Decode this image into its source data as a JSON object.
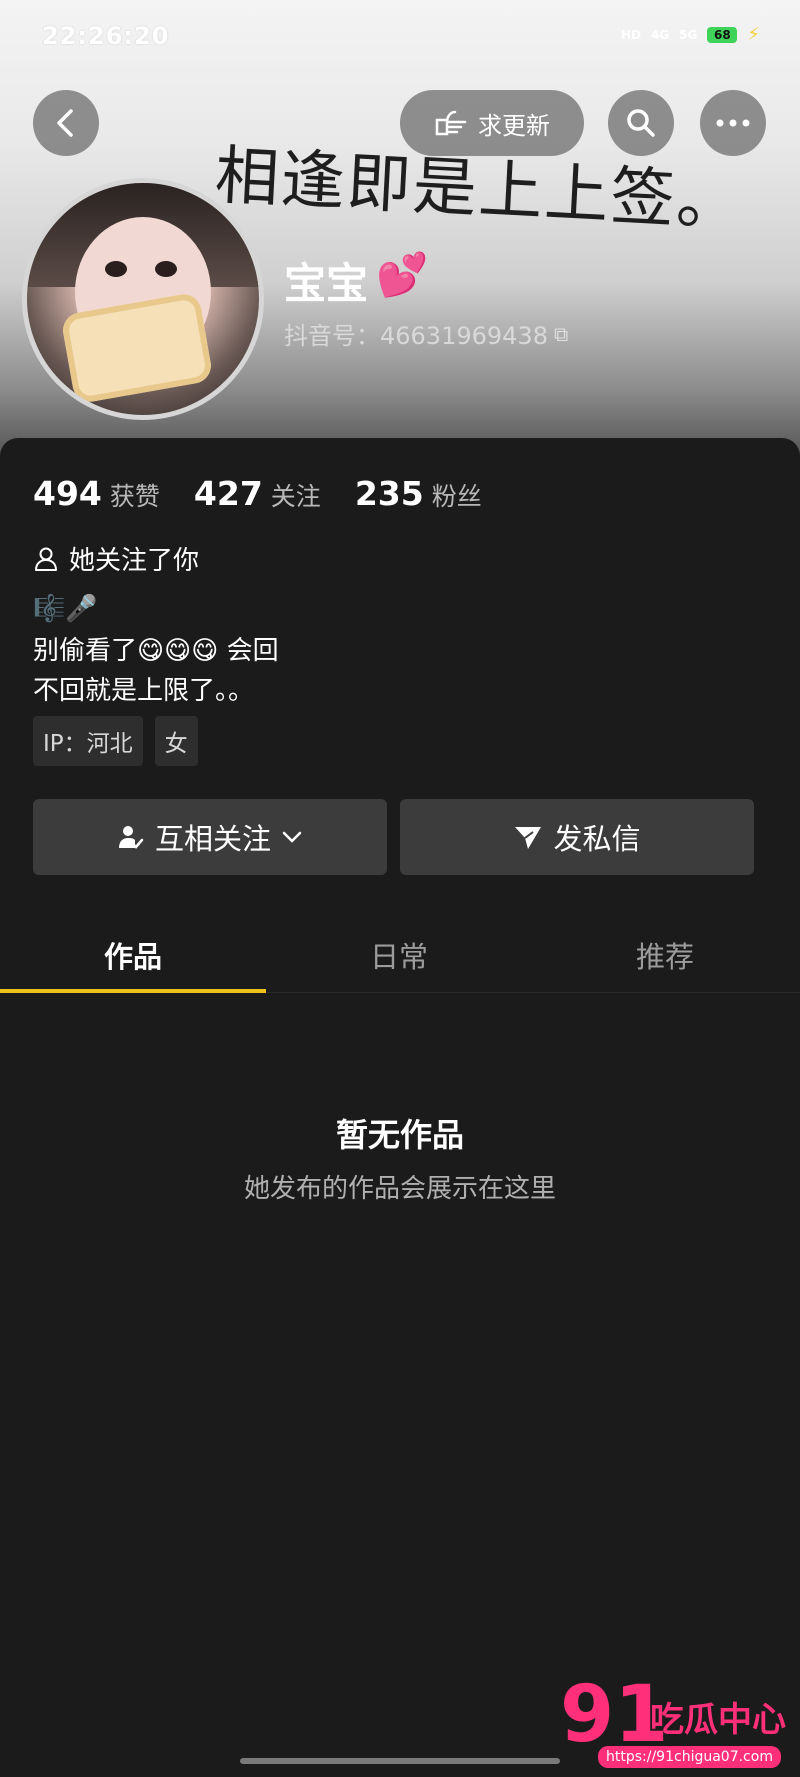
{
  "status_bar": {
    "time": "22:26:20",
    "icons": [
      "HD",
      "4G",
      "5G"
    ],
    "battery": "68"
  },
  "top_nav": {
    "update_label": "求更新"
  },
  "profile": {
    "signature": "相逢即是上上签。",
    "name": "宝宝",
    "name_emoji": "💕",
    "douyin_id": "抖音号：46631969438"
  },
  "stats": [
    {
      "value": "494",
      "label": "获赞"
    },
    {
      "value": "427",
      "label": "关注"
    },
    {
      "value": "235",
      "label": "粉丝"
    }
  ],
  "follow_note": "她关注了你",
  "bio": {
    "emoji_line": "🎼🎤",
    "line1": "别偷看了😋😋😋 会回",
    "line2": "不回就是上限了。。"
  },
  "tags": [
    "IP：河北",
    "女"
  ],
  "actions": {
    "mutual_label": "互相关注",
    "message_label": "发私信"
  },
  "tabs": [
    "作品",
    "日常",
    "推荐"
  ],
  "empty": {
    "title": "暂无作品",
    "subtitle": "她发布的作品会展示在这里"
  },
  "watermark": {
    "number": "91",
    "name": "吃瓜中心",
    "url": "https://91chigua07.com"
  },
  "colors": {
    "accent_underline": "#f0c21c",
    "background": "#1b1b1b",
    "watermark": "#ff2f7a"
  }
}
